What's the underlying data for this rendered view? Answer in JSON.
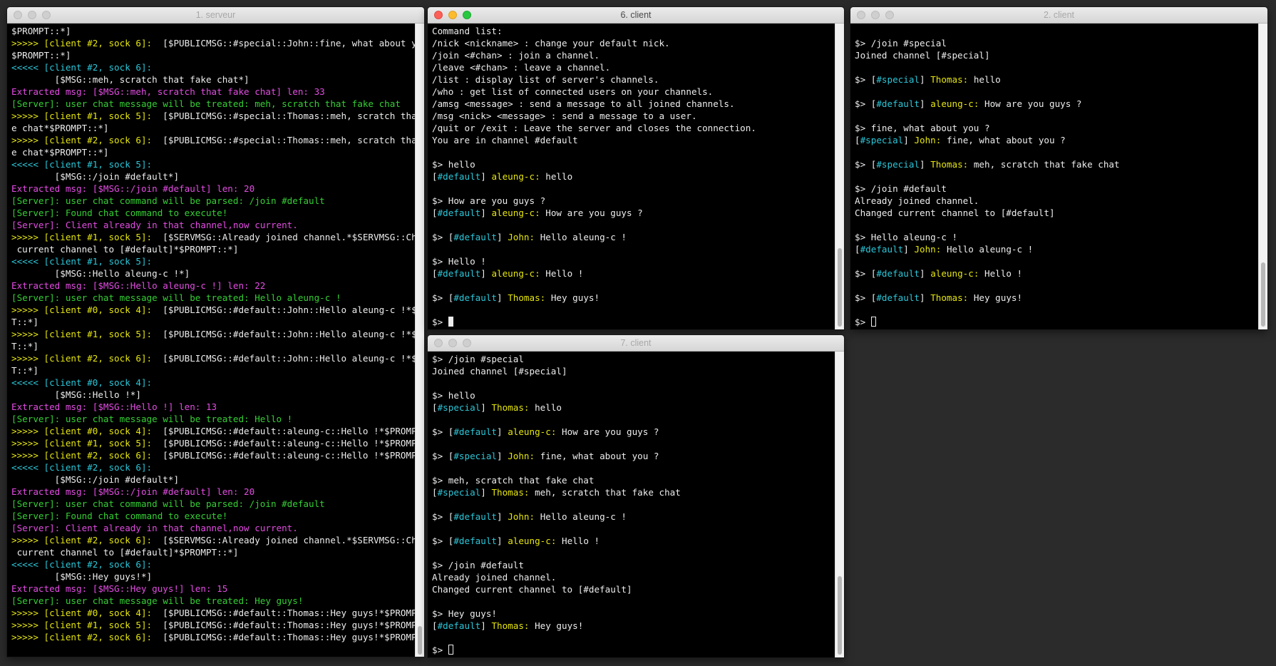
{
  "windows": {
    "serveur": {
      "title": "1. serveur",
      "lines": [
        [
          {
            "t": "$PROMPT::*]",
            "c": "w"
          }
        ],
        [
          {
            "t": ">>>>> [client #2, sock 6]:",
            "c": "y"
          },
          {
            "t": "  [$PUBLICMSG::#special::John::fine, what about you ?*",
            "c": "w"
          }
        ],
        [
          {
            "t": "$PROMPT::*]",
            "c": "w"
          }
        ],
        [
          {
            "t": "<<<<< [client #2, sock 6]:",
            "c": "c"
          }
        ],
        [
          {
            "t": "        [$MSG::meh, scratch that fake chat*]",
            "c": "w"
          }
        ],
        [
          {
            "t": "Extracted msg: [$MSG::meh, scratch that fake chat] len: 33",
            "c": "m"
          }
        ],
        [
          {
            "t": "[Server]: user chat message will be treated: meh, scratch that fake chat",
            "c": "g"
          }
        ],
        [
          {
            "t": ">>>>> [client #1, sock 5]:",
            "c": "y"
          },
          {
            "t": "  [$PUBLICMSG::#special::Thomas::meh, scratch that fak",
            "c": "w"
          }
        ],
        [
          {
            "t": "e chat*$PROMPT::*]",
            "c": "w"
          }
        ],
        [
          {
            "t": ">>>>> [client #2, sock 6]:",
            "c": "y"
          },
          {
            "t": "  [$PUBLICMSG::#special::Thomas::meh, scratch that fak",
            "c": "w"
          }
        ],
        [
          {
            "t": "e chat*$PROMPT::*]",
            "c": "w"
          }
        ],
        [
          {
            "t": "<<<<< [client #1, sock 5]:",
            "c": "c"
          }
        ],
        [
          {
            "t": "        [$MSG::/join #default*]",
            "c": "w"
          }
        ],
        [
          {
            "t": "Extracted msg: [$MSG::/join #default] len: 20",
            "c": "m"
          }
        ],
        [
          {
            "t": "[Server]: user chat command will be parsed: /join #default",
            "c": "g"
          }
        ],
        [
          {
            "t": "[Server]: Found chat command to execute!",
            "c": "g"
          }
        ],
        [
          {
            "t": "[Server]: Client already in that channel,now current.",
            "c": "m"
          }
        ],
        [
          {
            "t": ">>>>> [client #1, sock 5]:",
            "c": "y"
          },
          {
            "t": "  [$SERVMSG::Already joined channel.*$SERVMSG::Changed",
            "c": "w"
          }
        ],
        [
          {
            "t": " current channel to [#default]*$PROMPT::*]",
            "c": "w"
          }
        ],
        [
          {
            "t": "<<<<< [client #1, sock 5]:",
            "c": "c"
          }
        ],
        [
          {
            "t": "        [$MSG::Hello aleung-c !*]",
            "c": "w"
          }
        ],
        [
          {
            "t": "Extracted msg: [$MSG::Hello aleung-c !] len: 22",
            "c": "m"
          }
        ],
        [
          {
            "t": "[Server]: user chat message will be treated: Hello aleung-c !",
            "c": "g"
          }
        ],
        [
          {
            "t": ">>>>> [client #0, sock 4]:",
            "c": "y"
          },
          {
            "t": "  [$PUBLICMSG::#default::John::Hello aleung-c !*$PROMP",
            "c": "w"
          }
        ],
        [
          {
            "t": "T::*]",
            "c": "w"
          }
        ],
        [
          {
            "t": ">>>>> [client #1, sock 5]:",
            "c": "y"
          },
          {
            "t": "  [$PUBLICMSG::#default::John::Hello aleung-c !*$PROMP",
            "c": "w"
          }
        ],
        [
          {
            "t": "T::*]",
            "c": "w"
          }
        ],
        [
          {
            "t": ">>>>> [client #2, sock 6]:",
            "c": "y"
          },
          {
            "t": "  [$PUBLICMSG::#default::John::Hello aleung-c !*$PROMP",
            "c": "w"
          }
        ],
        [
          {
            "t": "T::*]",
            "c": "w"
          }
        ],
        [
          {
            "t": "<<<<< [client #0, sock 4]:",
            "c": "c"
          }
        ],
        [
          {
            "t": "        [$MSG::Hello !*]",
            "c": "w"
          }
        ],
        [
          {
            "t": "Extracted msg: [$MSG::Hello !] len: 13",
            "c": "m"
          }
        ],
        [
          {
            "t": "[Server]: user chat message will be treated: Hello !",
            "c": "g"
          }
        ],
        [
          {
            "t": ">>>>> [client #0, sock 4]:",
            "c": "y"
          },
          {
            "t": "  [$PUBLICMSG::#default::aleung-c::Hello !*$PROMPT::*]",
            "c": "w"
          }
        ],
        [
          {
            "t": ">>>>> [client #1, sock 5]:",
            "c": "y"
          },
          {
            "t": "  [$PUBLICMSG::#default::aleung-c::Hello !*$PROMPT::*]",
            "c": "w"
          }
        ],
        [
          {
            "t": ">>>>> [client #2, sock 6]:",
            "c": "y"
          },
          {
            "t": "  [$PUBLICMSG::#default::aleung-c::Hello !*$PROMPT::*]",
            "c": "w"
          }
        ],
        [
          {
            "t": "<<<<< [client #2, sock 6]:",
            "c": "c"
          }
        ],
        [
          {
            "t": "        [$MSG::/join #default*]",
            "c": "w"
          }
        ],
        [
          {
            "t": "Extracted msg: [$MSG::/join #default] len: 20",
            "c": "m"
          }
        ],
        [
          {
            "t": "[Server]: user chat command will be parsed: /join #default",
            "c": "g"
          }
        ],
        [
          {
            "t": "[Server]: Found chat command to execute!",
            "c": "g"
          }
        ],
        [
          {
            "t": "[Server]: Client already in that channel,now current.",
            "c": "m"
          }
        ],
        [
          {
            "t": ">>>>> [client #2, sock 6]:",
            "c": "y"
          },
          {
            "t": "  [$SERVMSG::Already joined channel.*$SERVMSG::Changed",
            "c": "w"
          }
        ],
        [
          {
            "t": " current channel to [#default]*$PROMPT::*]",
            "c": "w"
          }
        ],
        [
          {
            "t": "<<<<< [client #2, sock 6]:",
            "c": "c"
          }
        ],
        [
          {
            "t": "        [$MSG::Hey guys!*]",
            "c": "w"
          }
        ],
        [
          {
            "t": "Extracted msg: [$MSG::Hey guys!] len: 15",
            "c": "m"
          }
        ],
        [
          {
            "t": "[Server]: user chat message will be treated: Hey guys!",
            "c": "g"
          }
        ],
        [
          {
            "t": ">>>>> [client #0, sock 4]:",
            "c": "y"
          },
          {
            "t": "  [$PUBLICMSG::#default::Thomas::Hey guys!*$PROMPT::*]",
            "c": "w"
          }
        ],
        [
          {
            "t": ">>>>> [client #1, sock 5]:",
            "c": "y"
          },
          {
            "t": "  [$PUBLICMSG::#default::Thomas::Hey guys!*$PROMPT::*]",
            "c": "w"
          }
        ],
        [
          {
            "t": ">>>>> [client #2, sock 6]:",
            "c": "y"
          },
          {
            "t": "  [$PUBLICMSG::#default::Thomas::Hey guys!*$PROMPT::*]",
            "c": "w"
          }
        ]
      ]
    },
    "client6": {
      "title": "6. client",
      "lines": [
        [
          {
            "t": "Command list:",
            "c": "w"
          }
        ],
        [
          {
            "t": "/nick <nickname> : change your default nick.",
            "c": "w"
          }
        ],
        [
          {
            "t": "/join <#chan> : join a channel.",
            "c": "w"
          }
        ],
        [
          {
            "t": "/leave <#chan> : leave a channel.",
            "c": "w"
          }
        ],
        [
          {
            "t": "/list : display list of server's channels.",
            "c": "w"
          }
        ],
        [
          {
            "t": "/who : get list of connected users on your channels.",
            "c": "w"
          }
        ],
        [
          {
            "t": "/amsg <message> : send a message to all joined channels.",
            "c": "w"
          }
        ],
        [
          {
            "t": "/msg <nick> <message> : send a message to a user.",
            "c": "w"
          }
        ],
        [
          {
            "t": "/quit or /exit : Leave the server and closes the connection.",
            "c": "w"
          }
        ],
        [
          {
            "t": "You are in channel #default",
            "c": "w"
          }
        ],
        [],
        [
          {
            "t": "$> hello",
            "c": "w"
          }
        ],
        [
          {
            "t": "[",
            "c": "w"
          },
          {
            "t": "#default",
            "c": "c"
          },
          {
            "t": "] ",
            "c": "w"
          },
          {
            "t": "aleung-c:",
            "c": "y"
          },
          {
            "t": " hello",
            "c": "w"
          }
        ],
        [],
        [
          {
            "t": "$> How are you guys ?",
            "c": "w"
          }
        ],
        [
          {
            "t": "[",
            "c": "w"
          },
          {
            "t": "#default",
            "c": "c"
          },
          {
            "t": "] ",
            "c": "w"
          },
          {
            "t": "aleung-c:",
            "c": "y"
          },
          {
            "t": " How are you guys ?",
            "c": "w"
          }
        ],
        [],
        [
          {
            "t": "$> [",
            "c": "w"
          },
          {
            "t": "#default",
            "c": "c"
          },
          {
            "t": "] ",
            "c": "w"
          },
          {
            "t": "John:",
            "c": "y"
          },
          {
            "t": " Hello aleung-c !",
            "c": "w"
          }
        ],
        [],
        [
          {
            "t": "$> Hello !",
            "c": "w"
          }
        ],
        [
          {
            "t": "[",
            "c": "w"
          },
          {
            "t": "#default",
            "c": "c"
          },
          {
            "t": "] ",
            "c": "w"
          },
          {
            "t": "aleung-c:",
            "c": "y"
          },
          {
            "t": " Hello !",
            "c": "w"
          }
        ],
        [],
        [
          {
            "t": "$> [",
            "c": "w"
          },
          {
            "t": "#default",
            "c": "c"
          },
          {
            "t": "] ",
            "c": "w"
          },
          {
            "t": "Thomas:",
            "c": "y"
          },
          {
            "t": " Hey guys!",
            "c": "w"
          }
        ],
        [],
        [
          {
            "t": "$> ",
            "c": "w"
          }
        ]
      ]
    },
    "client7": {
      "title": "7. client",
      "lines": [
        [
          {
            "t": "$> /join #special",
            "c": "w"
          }
        ],
        [
          {
            "t": "Joined channel [#special]",
            "c": "w"
          }
        ],
        [],
        [
          {
            "t": "$> hello",
            "c": "w"
          }
        ],
        [
          {
            "t": "[",
            "c": "w"
          },
          {
            "t": "#special",
            "c": "c"
          },
          {
            "t": "] ",
            "c": "w"
          },
          {
            "t": "Thomas:",
            "c": "y"
          },
          {
            "t": " hello",
            "c": "w"
          }
        ],
        [],
        [
          {
            "t": "$> [",
            "c": "w"
          },
          {
            "t": "#default",
            "c": "c"
          },
          {
            "t": "] ",
            "c": "w"
          },
          {
            "t": "aleung-c:",
            "c": "y"
          },
          {
            "t": " How are you guys ?",
            "c": "w"
          }
        ],
        [],
        [
          {
            "t": "$> [",
            "c": "w"
          },
          {
            "t": "#special",
            "c": "c"
          },
          {
            "t": "] ",
            "c": "w"
          },
          {
            "t": "John:",
            "c": "y"
          },
          {
            "t": " fine, what about you ?",
            "c": "w"
          }
        ],
        [],
        [
          {
            "t": "$> meh, scratch that fake chat",
            "c": "w"
          }
        ],
        [
          {
            "t": "[",
            "c": "w"
          },
          {
            "t": "#special",
            "c": "c"
          },
          {
            "t": "] ",
            "c": "w"
          },
          {
            "t": "Thomas:",
            "c": "y"
          },
          {
            "t": " meh, scratch that fake chat",
            "c": "w"
          }
        ],
        [],
        [
          {
            "t": "$> [",
            "c": "w"
          },
          {
            "t": "#default",
            "c": "c"
          },
          {
            "t": "] ",
            "c": "w"
          },
          {
            "t": "John:",
            "c": "y"
          },
          {
            "t": " Hello aleung-c !",
            "c": "w"
          }
        ],
        [],
        [
          {
            "t": "$> [",
            "c": "w"
          },
          {
            "t": "#default",
            "c": "c"
          },
          {
            "t": "] ",
            "c": "w"
          },
          {
            "t": "aleung-c:",
            "c": "y"
          },
          {
            "t": " Hello !",
            "c": "w"
          }
        ],
        [],
        [
          {
            "t": "$> /join #default",
            "c": "w"
          }
        ],
        [
          {
            "t": "Already joined channel.",
            "c": "w"
          }
        ],
        [
          {
            "t": "Changed current channel to [#default]",
            "c": "w"
          }
        ],
        [],
        [
          {
            "t": "$> Hey guys!",
            "c": "w"
          }
        ],
        [
          {
            "t": "[",
            "c": "w"
          },
          {
            "t": "#default",
            "c": "c"
          },
          {
            "t": "] ",
            "c": "w"
          },
          {
            "t": "Thomas:",
            "c": "y"
          },
          {
            "t": " Hey guys!",
            "c": "w"
          }
        ],
        [],
        [
          {
            "t": "$> ",
            "c": "w"
          }
        ]
      ]
    },
    "client2": {
      "title": "2. client",
      "lines": [
        [],
        [
          {
            "t": "$> /join #special",
            "c": "w"
          }
        ],
        [
          {
            "t": "Joined channel [#special]",
            "c": "w"
          }
        ],
        [],
        [
          {
            "t": "$> [",
            "c": "w"
          },
          {
            "t": "#special",
            "c": "c"
          },
          {
            "t": "] ",
            "c": "w"
          },
          {
            "t": "Thomas:",
            "c": "y"
          },
          {
            "t": " hello",
            "c": "w"
          }
        ],
        [],
        [
          {
            "t": "$> [",
            "c": "w"
          },
          {
            "t": "#default",
            "c": "c"
          },
          {
            "t": "] ",
            "c": "w"
          },
          {
            "t": "aleung-c:",
            "c": "y"
          },
          {
            "t": " How are you guys ?",
            "c": "w"
          }
        ],
        [],
        [
          {
            "t": "$> fine, what about you ?",
            "c": "w"
          }
        ],
        [
          {
            "t": "[",
            "c": "w"
          },
          {
            "t": "#special",
            "c": "c"
          },
          {
            "t": "] ",
            "c": "w"
          },
          {
            "t": "John:",
            "c": "y"
          },
          {
            "t": " fine, what about you ?",
            "c": "w"
          }
        ],
        [],
        [
          {
            "t": "$> [",
            "c": "w"
          },
          {
            "t": "#special",
            "c": "c"
          },
          {
            "t": "] ",
            "c": "w"
          },
          {
            "t": "Thomas:",
            "c": "y"
          },
          {
            "t": " meh, scratch that fake chat",
            "c": "w"
          }
        ],
        [],
        [
          {
            "t": "$> /join #default",
            "c": "w"
          }
        ],
        [
          {
            "t": "Already joined channel.",
            "c": "w"
          }
        ],
        [
          {
            "t": "Changed current channel to [#default]",
            "c": "w"
          }
        ],
        [],
        [
          {
            "t": "$> Hello aleung-c !",
            "c": "w"
          }
        ],
        [
          {
            "t": "[",
            "c": "w"
          },
          {
            "t": "#default",
            "c": "c"
          },
          {
            "t": "] ",
            "c": "w"
          },
          {
            "t": "John:",
            "c": "y"
          },
          {
            "t": " Hello aleung-c !",
            "c": "w"
          }
        ],
        [],
        [
          {
            "t": "$> [",
            "c": "w"
          },
          {
            "t": "#default",
            "c": "c"
          },
          {
            "t": "] ",
            "c": "w"
          },
          {
            "t": "aleung-c:",
            "c": "y"
          },
          {
            "t": " Hello !",
            "c": "w"
          }
        ],
        [],
        [
          {
            "t": "$> [",
            "c": "w"
          },
          {
            "t": "#default",
            "c": "c"
          },
          {
            "t": "] ",
            "c": "w"
          },
          {
            "t": "Thomas:",
            "c": "y"
          },
          {
            "t": " Hey guys!",
            "c": "w"
          }
        ],
        [],
        [
          {
            "t": "$> ",
            "c": "w"
          }
        ]
      ]
    }
  },
  "colors": {
    "background": "#2b2b2b",
    "terminal_bg": "#000000",
    "text": "#ededed",
    "yellow": "#e5e510",
    "cyan": "#2bc6d8",
    "magenta": "#e34ce3",
    "green": "#34cf34"
  }
}
